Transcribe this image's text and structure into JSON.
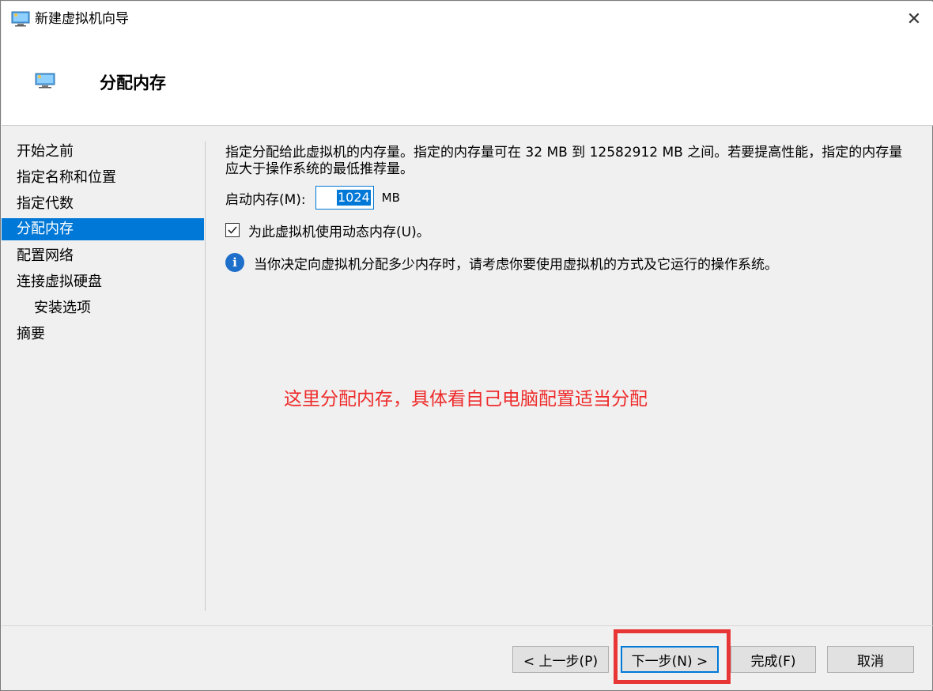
{
  "window": {
    "title": "新建虚拟机向导",
    "close_symbol": "✕"
  },
  "header": {
    "title": "分配内存"
  },
  "nav": {
    "items": [
      {
        "label": "开始之前",
        "active": false
      },
      {
        "label": "指定名称和位置",
        "active": false
      },
      {
        "label": "指定代数",
        "active": false
      },
      {
        "label": "分配内存",
        "active": true
      },
      {
        "label": "配置网络",
        "active": false
      },
      {
        "label": "连接虚拟硬盘",
        "active": false
      },
      {
        "label": "安装选项",
        "active": false,
        "sub": true
      },
      {
        "label": "摘要",
        "active": false
      }
    ]
  },
  "main": {
    "description": "指定分配给此虚拟机的内存量。指定的内存量可在 32 MB 到 12582912 MB 之间。若要提高性能，指定的内存量应大于操作系统的最低推荐量。",
    "startup_memory_label": "启动内存(M):",
    "startup_memory_value": "1024",
    "startup_memory_unit": "MB",
    "dynamic_memory_label": "为此虚拟机使用动态内存(U)。",
    "dynamic_memory_checked": true,
    "info_text": "当你决定向虚拟机分配多少内存时，请考虑你要使用虚拟机的方式及它运行的操作系统。"
  },
  "annotation": {
    "text": "这里分配内存，具体看自己电脑配置适当分配",
    "color": "#ee2b2b"
  },
  "buttons": {
    "back": "< 上一步(P)",
    "next": "下一步(N) >",
    "finish": "完成(F)",
    "cancel": "取消"
  },
  "colors": {
    "accent": "#0078d7",
    "highlight_box": "#e83535"
  }
}
